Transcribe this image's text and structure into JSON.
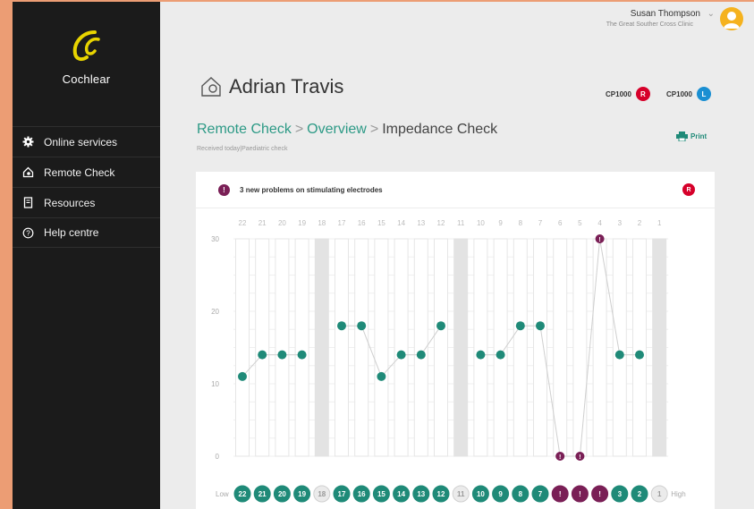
{
  "sidebar": {
    "brand": "Cochlear",
    "items": [
      {
        "label": "Online services",
        "icon": "gear-icon"
      },
      {
        "label": "Remote Check",
        "icon": "home-head-icon"
      },
      {
        "label": "Resources",
        "icon": "document-icon"
      },
      {
        "label": "Help centre",
        "icon": "help-icon"
      }
    ]
  },
  "user": {
    "name": "Susan Thompson",
    "clinic": "The Great Souther Cross Clinic"
  },
  "patient": {
    "name": "Adrian Travis",
    "processors": [
      {
        "model": "CP1000",
        "side": "R",
        "color": "#d6002a"
      },
      {
        "model": "CP1000",
        "side": "L",
        "color": "#1a8fd2"
      }
    ]
  },
  "breadcrumb": {
    "remote_check": "Remote Check",
    "overview": "Overview",
    "current": "Impedance Check"
  },
  "subtitle": {
    "received": "Received today",
    "type": "Paediatric check"
  },
  "print_label": "Print",
  "alert": {
    "count": "3",
    "text": "new problems on stimulating electrodes",
    "side": "R"
  },
  "colors": {
    "ok": "#1f8a78",
    "problem": "#7a1f56",
    "inactive": "#e0e0e0",
    "accent": "#2d9a86"
  },
  "chart_data": {
    "type": "line",
    "x": [
      "22",
      "21",
      "20",
      "19",
      "18",
      "17",
      "16",
      "15",
      "14",
      "13",
      "12",
      "11",
      "10",
      "9",
      "8",
      "7",
      "6",
      "5",
      "4",
      "3",
      "2",
      "1"
    ],
    "values": [
      11,
      14,
      14,
      14,
      null,
      18,
      18,
      11,
      14,
      14,
      18,
      null,
      14,
      14,
      18,
      18,
      0,
      0,
      30,
      14,
      14,
      null
    ],
    "status": [
      "ok",
      "ok",
      "ok",
      "ok",
      "inactive",
      "ok",
      "ok",
      "ok",
      "ok",
      "ok",
      "ok",
      "inactive",
      "ok",
      "ok",
      "ok",
      "ok",
      "problem",
      "problem",
      "problem",
      "ok",
      "ok",
      "inactive"
    ],
    "ylim": [
      0,
      30
    ],
    "yticks": [
      0,
      10,
      20,
      30
    ],
    "low_label": "Low",
    "high_label": "High",
    "problem_marker": "!"
  }
}
